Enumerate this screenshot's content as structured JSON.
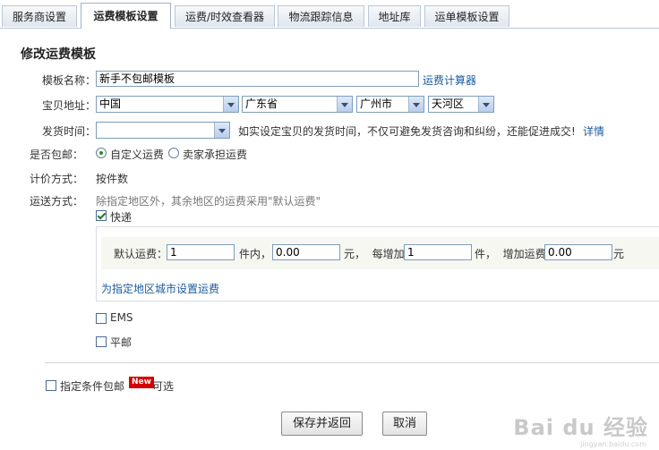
{
  "tabs": [
    {
      "label": "服务商设置",
      "active": false
    },
    {
      "label": "运费模板设置",
      "active": true
    },
    {
      "label": "运费/时效查看器",
      "active": false
    },
    {
      "label": "物流跟踪信息",
      "active": false
    },
    {
      "label": "地址库",
      "active": false
    },
    {
      "label": "运单模板设置",
      "active": false
    }
  ],
  "form": {
    "section_title": "修改运费模板",
    "template_name_label": "模板名称：",
    "template_name_value": "新手不包邮模板",
    "calculator_link": "运费计算器",
    "address_label": "宝贝地址：",
    "country": "中国",
    "province": "广东省",
    "city": "广州市",
    "district": "天河区",
    "ship_time_label": "发货时间：",
    "ship_time_value": "",
    "ship_time_hint": "如实设定宝贝的发货时间，不仅可避免发货咨询和纠纷，还能促进成交!",
    "ship_time_detail_link": "详情",
    "free_ship_label": "是否包邮：",
    "radio_custom": "自定义运费",
    "radio_seller": "卖家承担运费",
    "pricing_label": "计价方式：",
    "pricing_value": "按件数",
    "delivery_label": "运送方式：",
    "delivery_hint": "除指定地区外，其余地区的运费采用\"默认运费\"",
    "express": {
      "label": "快递",
      "checked": true,
      "default_fee_label": "默认运费：",
      "first_qty": "1",
      "unit_within": "件内，",
      "first_fee": "0.00",
      "unit_yuan_each": "元，  每增加",
      "add_qty": "1",
      "unit_piece_add": "件，  增加运费",
      "add_fee": "0.00",
      "unit_yuan": "元",
      "region_link": "为指定地区城市设置运费"
    },
    "ems": {
      "label": "EMS",
      "checked": false
    },
    "post": {
      "label": "平邮",
      "checked": false
    },
    "conditional_free": {
      "label": "指定条件包邮",
      "badge": "New",
      "suffix": "可选",
      "checked": false
    }
  },
  "buttons": {
    "save": "保存并返回",
    "cancel": "取消"
  },
  "watermark": {
    "text": "Bai du 经验",
    "sub": "jingyan.baidu.com"
  }
}
